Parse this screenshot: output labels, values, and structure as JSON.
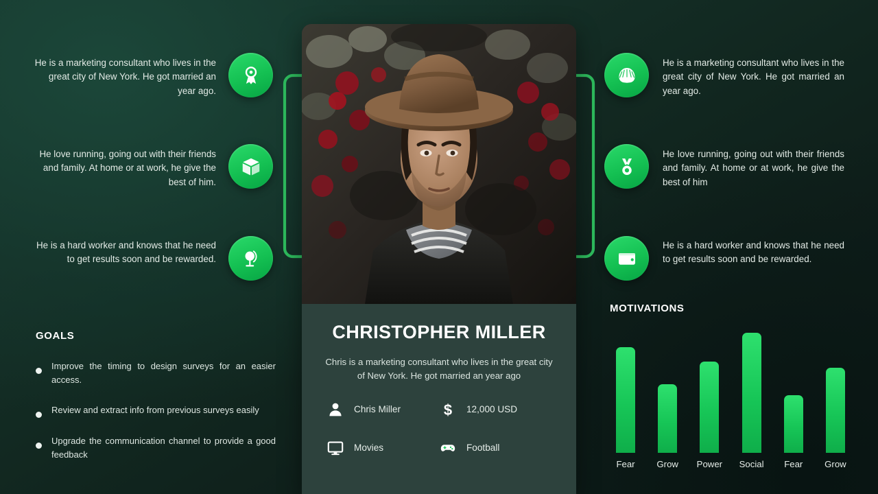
{
  "left_notes": [
    {
      "text": "He is a marketing consultant who lives in the great city of New York. He got married an year ago.",
      "icon": "award-ribbon-icon"
    },
    {
      "text": "He love running, going out with their friends and family. At home or at work, he give the best of him.",
      "icon": "package-box-icon"
    },
    {
      "text": "He is a hard worker and knows that he need to get results soon and be rewarded.",
      "icon": "globe-stand-icon"
    }
  ],
  "right_notes": [
    {
      "text": "He is a marketing consultant who lives in the great city of New York. He got married an year ago.",
      "icon": "shell-icon"
    },
    {
      "text": "He love running, going out with their friends and family. At home or at work, he give the best of him",
      "icon": "medal-icon"
    },
    {
      "text": "He is a hard worker and knows that he need to get results soon and be rewarded.",
      "icon": "wallet-icon"
    }
  ],
  "card": {
    "photo_alt": "portrait-photo",
    "name": "CHRISTOPHER MILLER",
    "description": "Chris is a marketing consultant who lives in the great city of New York. He got married an year ago",
    "facts": [
      {
        "icon": "person-icon",
        "value": "Chris Miller"
      },
      {
        "icon": "dollar-icon",
        "value": "12,000 USD"
      },
      {
        "icon": "monitor-icon",
        "value": "Movies"
      },
      {
        "icon": "gamepad-icon",
        "value": "Football"
      }
    ]
  },
  "goals": {
    "title": "GOALS",
    "items": [
      "Improve the timing to design surveys for an easier access.",
      "Review and extract info from previous surveys easily",
      "Upgrade the communication channel to provide a good feedback"
    ]
  },
  "chart_data": {
    "type": "bar",
    "title": "MOTIVATIONS",
    "categories": [
      "Fear",
      "Grow",
      "Power",
      "Social",
      "Fear",
      "Grow"
    ],
    "values": [
      88,
      57,
      76,
      100,
      48,
      71
    ],
    "xlabel": "",
    "ylabel": "",
    "ylim": [
      0,
      100
    ],
    "grid": false,
    "legend": false,
    "bar_color": "#17c657"
  },
  "colors": {
    "accent_green": "#17c657",
    "accent_green_light": "#2ee06e",
    "background_top": "#17392f",
    "background_bottom": "#0c1714",
    "card_panel": "#2d423d",
    "text_primary": "#ffffff",
    "text_secondary": "#dee7e2"
  }
}
